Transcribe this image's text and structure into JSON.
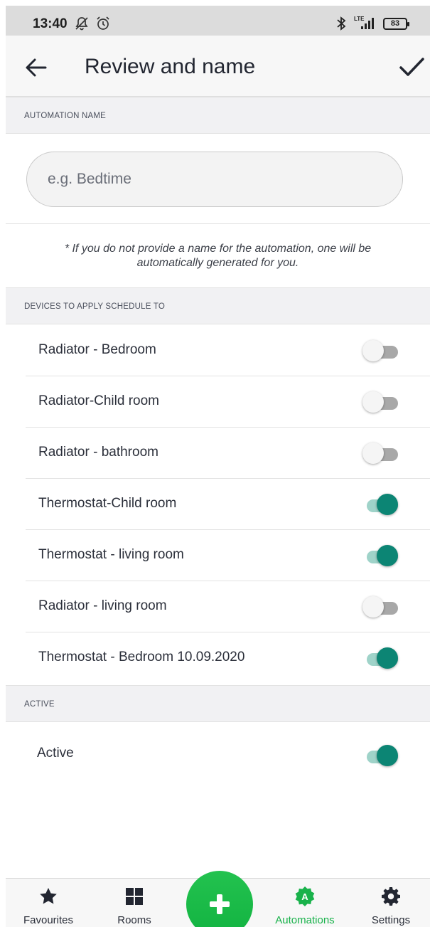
{
  "status_bar": {
    "time": "13:40",
    "icons": [
      "notifications-off-icon",
      "alarm-icon",
      "bluetooth-icon",
      "lte-signal-icon"
    ],
    "network": "LTE",
    "battery": "83"
  },
  "app_bar": {
    "title": "Review and name",
    "back_icon": "back-arrow-icon",
    "confirm_icon": "checkmark-icon"
  },
  "automation_name": {
    "header": "AUTOMATION NAME",
    "placeholder": "e.g. Bedtime",
    "value": "",
    "note": "* If you do not provide a name for the automation, one will be automatically generated for you."
  },
  "devices": {
    "header": "DEVICES TO APPLY SCHEDULE TO",
    "items": [
      {
        "label": "Radiator - Bedroom",
        "enabled": false
      },
      {
        "label": "Radiator-Child room",
        "enabled": false
      },
      {
        "label": "Radiator - bathroom",
        "enabled": false
      },
      {
        "label": "Thermostat-Child room",
        "enabled": true
      },
      {
        "label": "Thermostat - living room",
        "enabled": true
      },
      {
        "label": "Radiator - living room",
        "enabled": false
      },
      {
        "label": "Thermostat - Bedroom 10.09.2020",
        "enabled": true
      }
    ]
  },
  "active": {
    "header": "ACTIVE",
    "label": "Active",
    "enabled": true
  },
  "bottom_nav": {
    "items": [
      {
        "label": "Favourites",
        "icon": "star-icon",
        "active": false
      },
      {
        "label": "Rooms",
        "icon": "grid-icon",
        "active": false
      },
      {
        "label": "Automations",
        "icon": "automation-badge-icon",
        "active": true
      },
      {
        "label": "Settings",
        "icon": "gear-icon",
        "active": false
      }
    ],
    "fab_icon": "plus-icon"
  },
  "colors": {
    "accent_green": "#19b24b",
    "toggle_on": "#0c8574",
    "toggle_on_track": "#9fd3c9",
    "toggle_off_track": "#a8a8a8"
  }
}
